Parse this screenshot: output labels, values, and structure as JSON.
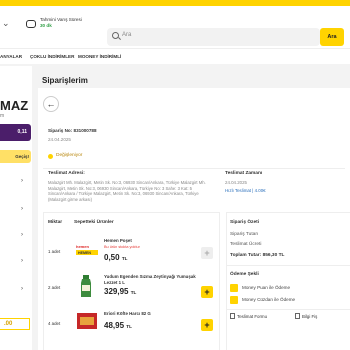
{
  "header": {
    "delivery_label": "Tahmini Varış Süresi",
    "delivery_time": "30 dk",
    "search_placeholder": "Ara",
    "search_button": "Ara"
  },
  "nav": {
    "items": [
      "ANYALAR",
      "ÇOKLU İNDİRİMLER",
      "MOONEY İNDİRİMLİ"
    ]
  },
  "sidebar": {
    "name_fragment": "MAZ",
    "sub_fragment": "m",
    "purple_value": "0,11",
    "yellow_label": "Geçiş!"
  },
  "page": {
    "title": "Siparişlerim"
  },
  "order": {
    "number": "Sipariş No: 831000788",
    "date": "24.04.2025",
    "status": "Değişleniyor",
    "delivery_address_title": "Teslimat Adresi:",
    "delivery_address": "Malazgirt Mh. Malazgirt, Metin Sk. No:3, 06930 Sincan/Ankara, Türkiye Malazgirt Mh. Malazgirt, Metin Sk. No:3, 06930 Sincan/Ankara, Türkiye No: 3 Sahe: 3 Kat: 5 Sincan/Ankara / Türkiye Malazgirt, Metin Sk. No:3, 06930 Sincan/Ankara, Türkiye (Malazgirt girme arkası)",
    "delivery_time_title": "Teslimat Zamanı",
    "delivery_time_date": "24.04.2025",
    "delivery_time_fast": "Hızlı Teslimat | 4.00€"
  },
  "products": {
    "col_qty": "Miktar",
    "col_name": "Sepetteki Ürünler",
    "items": [
      {
        "qty": "1 adet",
        "name": "Hemen Poşet",
        "note": "Bu ürün stokta yoktur",
        "price": "0,50",
        "currency": "TL"
      },
      {
        "qty": "2 adet",
        "name": "Yudum Egenden Sızma Zeytinyağı Yumuşak Lezzet 1 L",
        "note": "",
        "price": "329,95",
        "currency": "TL"
      },
      {
        "qty": "4 adet",
        "name": "Eriori Köfte Harcı 82 G",
        "note": "",
        "price": "48,95",
        "currency": "TL"
      }
    ]
  },
  "summary": {
    "title": "Sipariş Özeti",
    "subtotal_label": "Sipariş Tutarı",
    "delivery_fee_label": "Teslimat Ücreti",
    "total": "Toplam Tutar: 856,30 TL",
    "payment_title": "Ödeme Şekli",
    "payment_options": [
      "Money Puan ile Ödeme",
      "Money Cüzdan ile Ödeme"
    ],
    "link_delivery_form": "Teslimat Formu",
    "link_info": "Bilgi Fiş"
  },
  "colors": {
    "accent": "#ffd300",
    "purple": "#4b1e6a",
    "danger": "#e53935",
    "link": "#2a6fbb"
  }
}
